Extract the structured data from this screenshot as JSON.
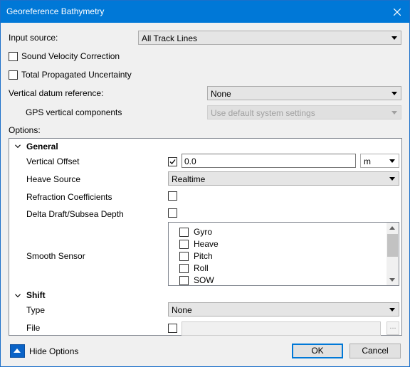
{
  "window": {
    "title": "Georeference Bathymetry"
  },
  "input_source": {
    "label": "Input source:",
    "value": "All Track Lines"
  },
  "sound_velocity": {
    "label": "Sound Velocity Correction",
    "checked": false
  },
  "tpu": {
    "label": "Total Propagated Uncertainty",
    "checked": false
  },
  "vertical_datum": {
    "label": "Vertical datum reference:",
    "value": "None"
  },
  "gps_vertical": {
    "label": "GPS vertical components",
    "value": "Use default system settings"
  },
  "options_label": "Options:",
  "general": {
    "header": "General",
    "vertical_offset": {
      "label": "Vertical Offset",
      "checked": true,
      "value": "0.0",
      "unit": "m"
    },
    "heave_source": {
      "label": "Heave Source",
      "value": "Realtime"
    },
    "refraction": {
      "label": "Refraction Coefficients",
      "checked": false
    },
    "delta_draft": {
      "label": "Delta Draft/Subsea Depth",
      "checked": false
    },
    "smooth_sensor": {
      "label": "Smooth Sensor",
      "items": [
        {
          "label": "Gyro",
          "checked": false
        },
        {
          "label": "Heave",
          "checked": false
        },
        {
          "label": "Pitch",
          "checked": false
        },
        {
          "label": "Roll",
          "checked": false
        },
        {
          "label": "SOW",
          "checked": false
        }
      ]
    }
  },
  "shift": {
    "header": "Shift",
    "type": {
      "label": "Type",
      "value": "None"
    },
    "file": {
      "label": "File",
      "checked": false,
      "value": "",
      "browse": "..."
    }
  },
  "footer": {
    "hide_options": "Hide Options",
    "ok": "OK",
    "cancel": "Cancel"
  },
  "colors": {
    "titlebar": "#0078d7",
    "accent": "#0078d7"
  }
}
